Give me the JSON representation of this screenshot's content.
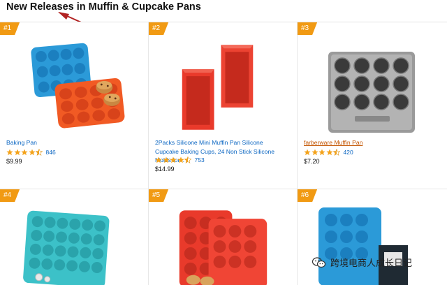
{
  "page": {
    "title": "New Releases in Muffin & Cupcake Pans"
  },
  "products": [
    {
      "rank": "#1",
      "title": "Baking Pan",
      "title_link_style": "blue",
      "rating": 4.5,
      "rating_count": "846",
      "price": "$9.99",
      "image_icon": "muffin-pan-image"
    },
    {
      "rank": "#2",
      "title": "2Packs Silicone Mini Muffin Pan Silicone Cupcake Baking Cups, 24 Non Stick Silicone Molds for...",
      "title_link_style": "blue",
      "rating": 4.5,
      "rating_count": "753",
      "price": "$14.99",
      "image_icon": "loaf-pan-image"
    },
    {
      "rank": "#3",
      "title": "farberware Muffin Pan",
      "title_link_style": "orange",
      "rating": 4.5,
      "rating_count": "420",
      "price": "$7.20",
      "image_icon": "metal-muffin-pan-image"
    },
    {
      "rank": "#4",
      "image_icon": "muffin-pan-image"
    },
    {
      "rank": "#5",
      "image_icon": "muffin-pan-image"
    },
    {
      "rank": "#6",
      "image_icon": "muffin-pan-image"
    }
  ],
  "watermark": {
    "text": "跨境电商人成长日记",
    "icon": "wechat-icon"
  },
  "colors": {
    "rank_badge": "#f19a13",
    "link_blue": "#0b66c2",
    "link_orange": "#c45500",
    "star": "#f4a31b",
    "pan_blue": "#2b9ad8",
    "pan_orange": "#f15a24",
    "pan_red": "#e93a2b",
    "pan_teal": "#3cc1c8",
    "pan_metal": "#9a9a9a"
  }
}
